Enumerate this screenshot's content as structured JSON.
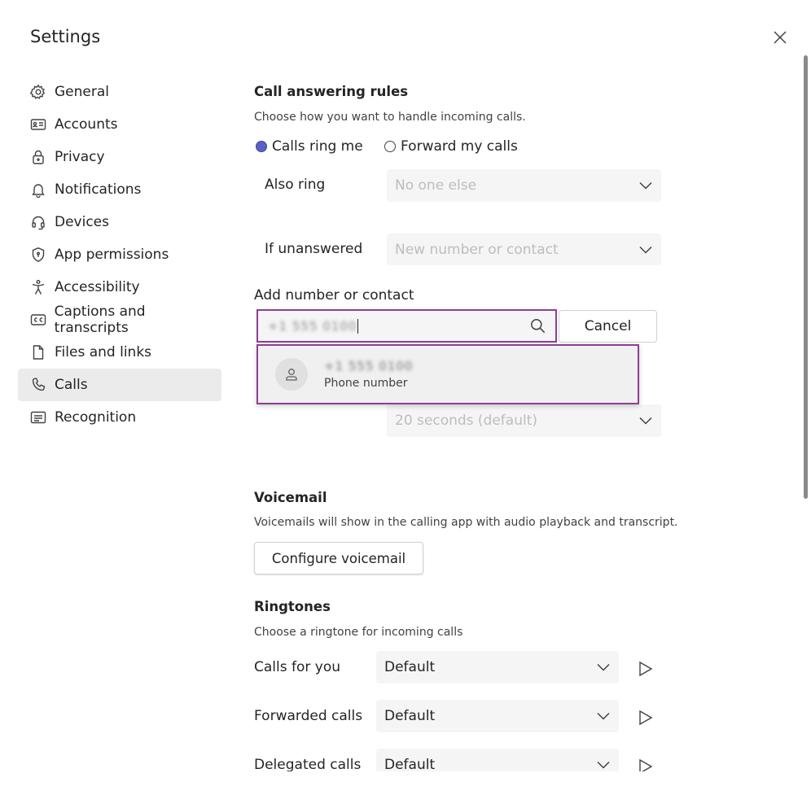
{
  "window": {
    "title": "Settings"
  },
  "sidebar": {
    "items": [
      {
        "label": "General",
        "icon": "gear-icon"
      },
      {
        "label": "Accounts",
        "icon": "id-card-icon"
      },
      {
        "label": "Privacy",
        "icon": "lock-icon"
      },
      {
        "label": "Notifications",
        "icon": "bell-icon"
      },
      {
        "label": "Devices",
        "icon": "headset-icon"
      },
      {
        "label": "App permissions",
        "icon": "shield-icon"
      },
      {
        "label": "Accessibility",
        "icon": "accessibility-icon"
      },
      {
        "label": "Captions and transcripts",
        "icon": "cc-icon"
      },
      {
        "label": "Files and links",
        "icon": "file-icon"
      },
      {
        "label": "Calls",
        "icon": "phone-icon"
      },
      {
        "label": "Recognition",
        "icon": "recognition-icon"
      }
    ],
    "active": "Calls"
  },
  "call_rules": {
    "heading": "Call answering rules",
    "description": "Choose how you want to handle incoming calls.",
    "option_ring": "Calls ring me",
    "option_forward": "Forward my calls",
    "selected": "Calls ring me",
    "also_ring_label": "Also ring",
    "also_ring_value": "No one else",
    "unanswered_label": "If unanswered",
    "unanswered_value": "New number or contact",
    "add_contact_label": "Add number or contact",
    "search_value": "+1 555 0100",
    "cancel_label": "Cancel",
    "suggestion_name": "+1 555 0100",
    "suggestion_type": "Phone number",
    "ring_time_value": "20 seconds (default)"
  },
  "voicemail": {
    "heading": "Voicemail",
    "description": "Voicemails will show in the calling app with audio playback and transcript.",
    "button": "Configure voicemail"
  },
  "ringtones": {
    "heading": "Ringtones",
    "description": "Choose a ringtone for incoming calls",
    "rows": [
      {
        "label": "Calls for you",
        "value": "Default"
      },
      {
        "label": "Forwarded calls",
        "value": "Default"
      },
      {
        "label": "Delegated calls",
        "value": "Default"
      }
    ]
  },
  "colors": {
    "accent": "#5b5fc7",
    "focus_border": "#8e3e94",
    "active_nav": "#ebebeb"
  }
}
